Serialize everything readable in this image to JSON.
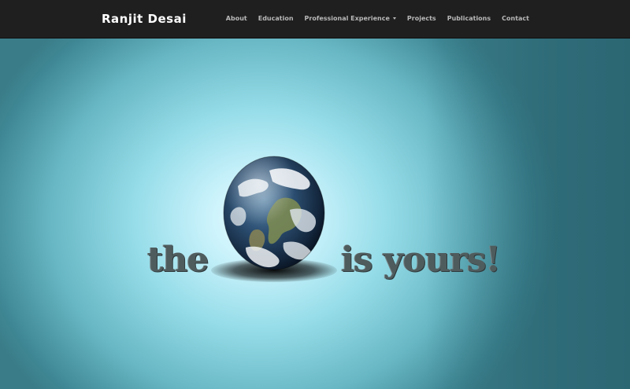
{
  "header": {
    "brand": "Ranjit Desai",
    "nav": [
      {
        "label": "About"
      },
      {
        "label": "Education"
      },
      {
        "label": "Professional Experience",
        "dropdown": true
      },
      {
        "label": "Projects"
      },
      {
        "label": "Publications"
      },
      {
        "label": "Contact"
      }
    ]
  },
  "hero": {
    "slogan_left": "the",
    "slogan_right": "is yours!",
    "globe_icon": "earth-globe"
  },
  "colors": {
    "navbar": "#1f1f1f",
    "brand_text": "#ffffff",
    "nav_text": "#b8b8b8",
    "hero_center": "#ecfdff",
    "hero_edge": "#2a6f7c",
    "slogan": "#4f5c5e"
  }
}
